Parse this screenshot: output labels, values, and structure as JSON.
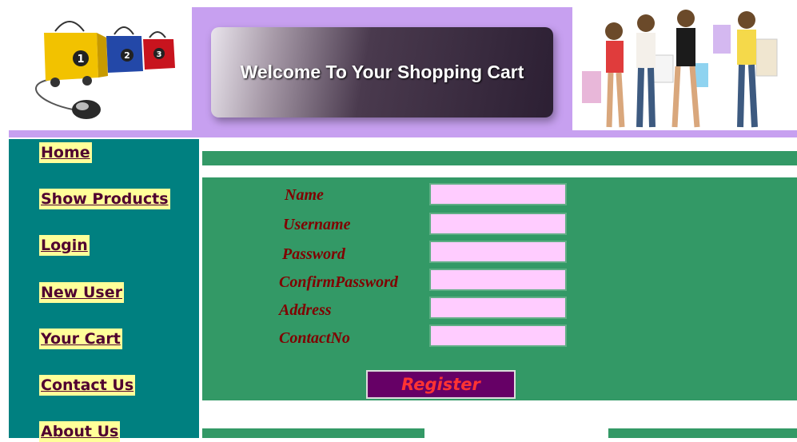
{
  "header": {
    "banner_title": "Welcome To Your Shopping Cart",
    "logo_icon": "shopping-bags-123-icon",
    "photo_icon": "shoppers-photo"
  },
  "sidebar": {
    "items": [
      {
        "label": "Home"
      },
      {
        "label": "Show Products"
      },
      {
        "label": "Login"
      },
      {
        "label": "New User"
      },
      {
        "label": "Your Cart"
      },
      {
        "label": "Contact Us"
      },
      {
        "label": "About Us"
      }
    ]
  },
  "form": {
    "fields": [
      {
        "label": "Name",
        "value": ""
      },
      {
        "label": "Username",
        "value": ""
      },
      {
        "label": "Password",
        "value": ""
      },
      {
        "label": "ConfirmPassword",
        "value": ""
      },
      {
        "label": "Address",
        "value": ""
      },
      {
        "label": "ContactNo",
        "value": ""
      }
    ],
    "register_label": "Register"
  },
  "colors": {
    "header_bg": "#c7a0f0",
    "sidebar_bg": "#008080",
    "panel_bg": "#339966",
    "nav_highlight": "#ffff99",
    "input_bg": "#ffccff",
    "button_bg": "#660066",
    "button_text": "#ff3333",
    "label_text": "#800000"
  }
}
